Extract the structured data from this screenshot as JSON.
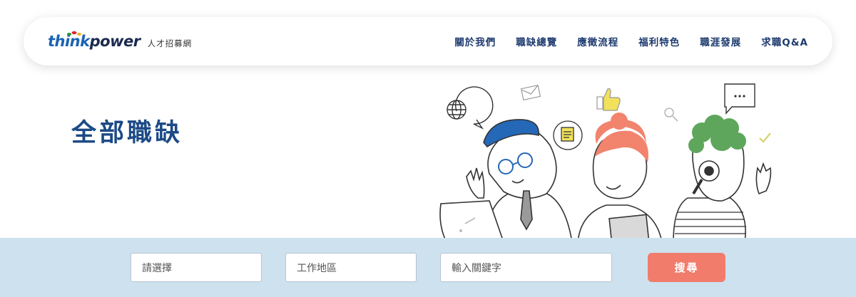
{
  "header": {
    "logo_think": "think",
    "logo_power": "power",
    "logo_subtitle": "人才招募網",
    "nav": [
      {
        "label": "關於我們"
      },
      {
        "label": "職缺總覽"
      },
      {
        "label": "應徵流程"
      },
      {
        "label": "福利特色"
      },
      {
        "label": "職涯發展"
      },
      {
        "label": "求職Q&A"
      }
    ]
  },
  "hero": {
    "title": "全部職缺"
  },
  "search": {
    "category_placeholder": "請選擇",
    "area_placeholder": "工作地區",
    "keyword_placeholder": "輸入關鍵字",
    "button_label": "搜尋"
  },
  "colors": {
    "brand_blue": "#1a63b4",
    "title_blue": "#1c4a86",
    "band_bg": "#cde1ef",
    "search_button": "#f27c6b"
  }
}
